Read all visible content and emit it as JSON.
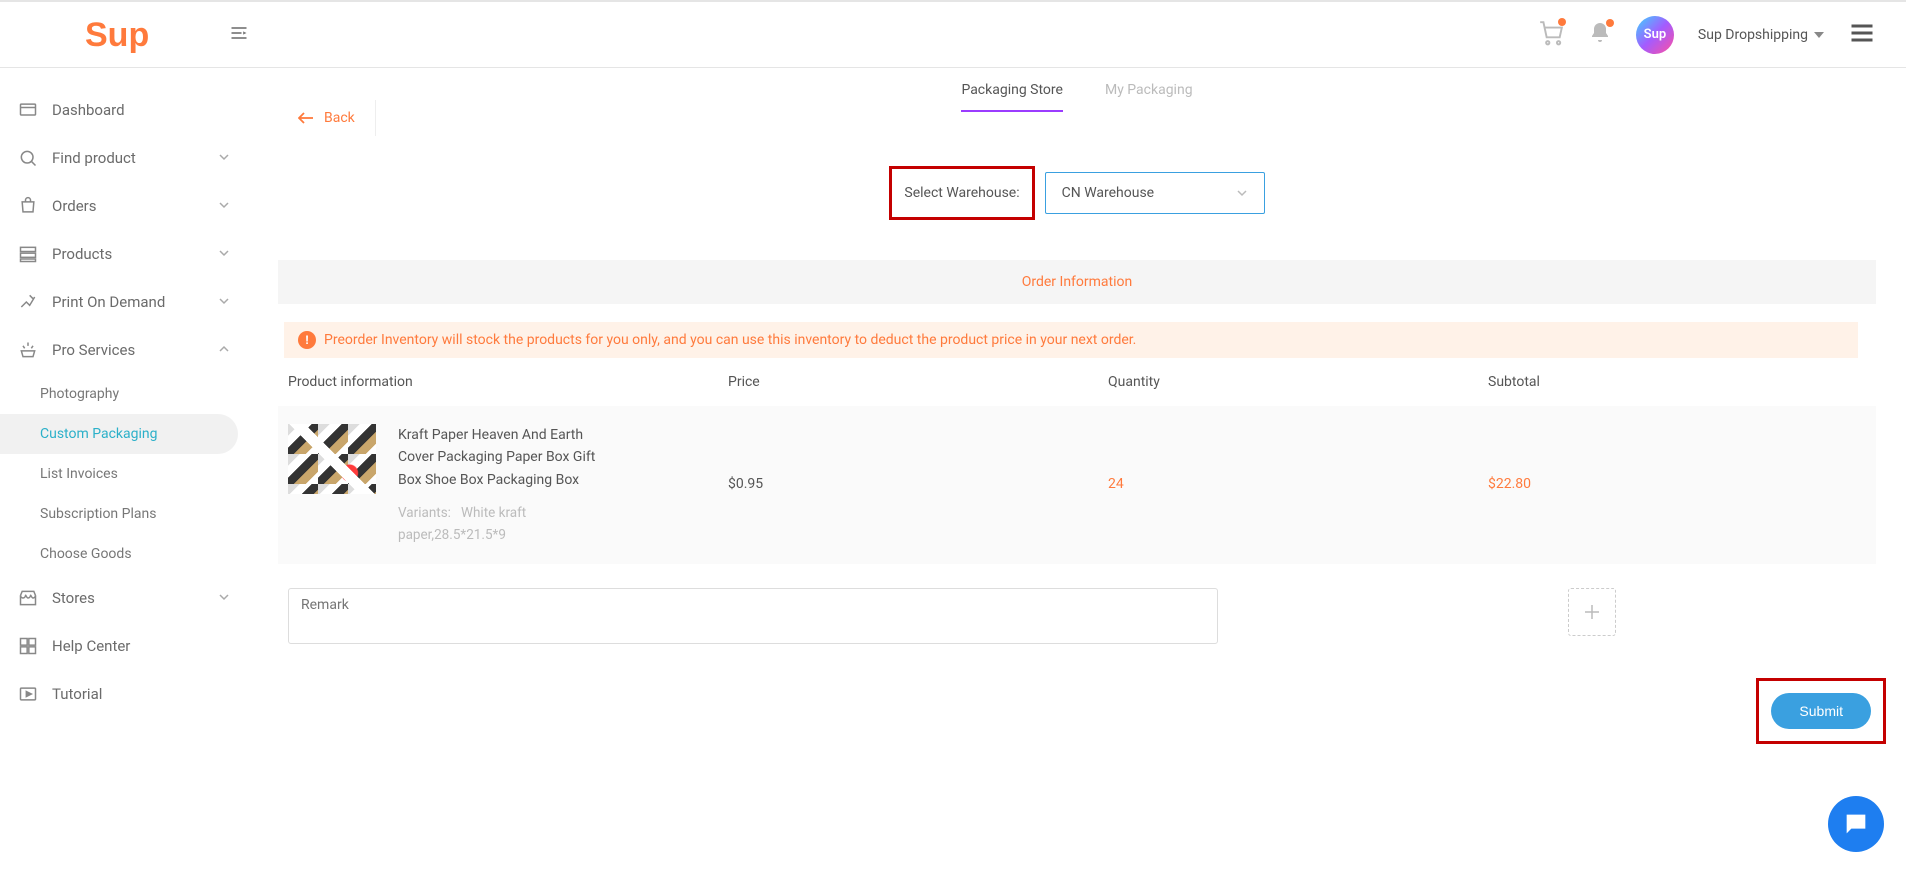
{
  "header": {
    "logo_text": "Sup",
    "account_name": "Sup Dropshipping",
    "avatar_text": "Sup"
  },
  "sidebar": {
    "items": [
      {
        "label": "Dashboard",
        "expandable": false
      },
      {
        "label": "Find product",
        "expandable": true
      },
      {
        "label": "Orders",
        "expandable": true
      },
      {
        "label": "Products",
        "expandable": true
      },
      {
        "label": "Print On Demand",
        "expandable": true
      },
      {
        "label": "Pro Services",
        "expandable": true,
        "expanded": true
      }
    ],
    "pro_services_sub": [
      {
        "label": "Photography"
      },
      {
        "label": "Custom Packaging",
        "active": true
      },
      {
        "label": "List Invoices"
      },
      {
        "label": "Subscription Plans"
      },
      {
        "label": "Choose Goods"
      }
    ],
    "items_after": [
      {
        "label": "Stores",
        "expandable": true
      },
      {
        "label": "Help Center",
        "expandable": false
      },
      {
        "label": "Tutorial",
        "expandable": false
      }
    ]
  },
  "tabs": {
    "packaging_store": "Packaging Store",
    "my_packaging": "My Packaging"
  },
  "back_label": "Back",
  "warehouse": {
    "label": "Select Warehouse:",
    "selected": "CN Warehouse"
  },
  "order_info_title": "Order Information",
  "warning_text": "Preorder Inventory will stock the products for you only, and you can use this inventory to deduct the product price in your next order.",
  "table": {
    "headers": {
      "product": "Product information",
      "price": "Price",
      "quantity": "Quantity",
      "subtotal": "Subtotal"
    },
    "rows": [
      {
        "title": "Kraft Paper Heaven And Earth Cover Packaging Paper Box Gift Box Shoe Box Packaging Box",
        "variants_label": "Variants:",
        "variants_value": "White kraft paper,28.5*21.5*9",
        "price": "$0.95",
        "quantity": "24",
        "subtotal": "$22.80"
      }
    ]
  },
  "remark_placeholder": "Remark",
  "submit_label": "Submit"
}
